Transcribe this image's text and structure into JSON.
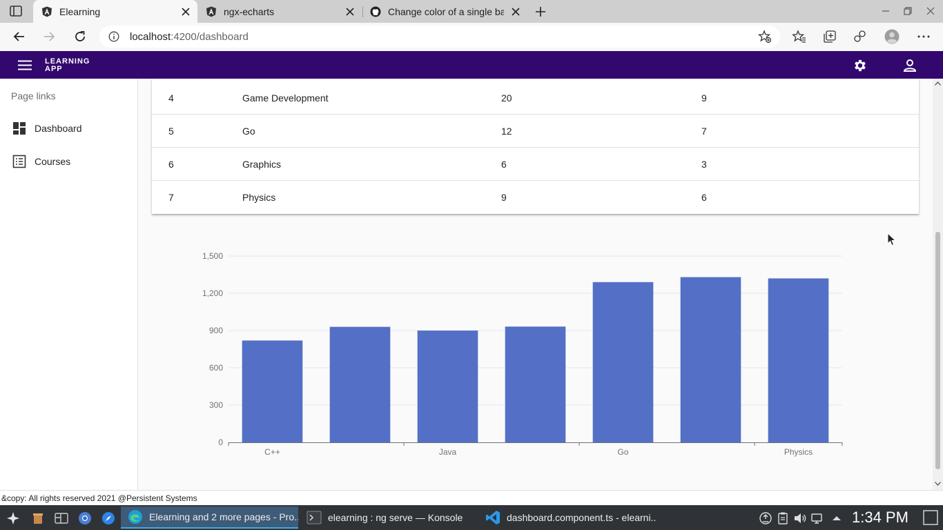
{
  "browser": {
    "tabs": [
      {
        "title": "Elearning",
        "icon": "angular-icon",
        "active": true
      },
      {
        "title": "ngx-echarts",
        "icon": "angular-icon",
        "active": false
      },
      {
        "title": "Change color of a single bar i",
        "icon": "github-icon",
        "active": false
      }
    ],
    "url_host": "localhost",
    "url_path": ":4200/dashboard"
  },
  "app": {
    "brand_line1": "LEARNING",
    "brand_line2": "APP"
  },
  "sidebar": {
    "heading": "Page links",
    "items": [
      {
        "label": "Dashboard",
        "icon": "dashboard-icon"
      },
      {
        "label": "Courses",
        "icon": "list-icon"
      }
    ]
  },
  "table": {
    "rows": [
      {
        "id": "4",
        "name": "Game Development",
        "col3": "20",
        "col4": "9"
      },
      {
        "id": "5",
        "name": "Go",
        "col3": "12",
        "col4": "7"
      },
      {
        "id": "6",
        "name": "Graphics",
        "col3": "6",
        "col4": "3"
      },
      {
        "id": "7",
        "name": "Physics",
        "col3": "9",
        "col4": "6"
      }
    ]
  },
  "chart_data": {
    "type": "bar",
    "categories": [
      "C++",
      "",
      "Java",
      "",
      "Go",
      "",
      "Physics"
    ],
    "values": [
      820,
      930,
      900,
      932,
      1290,
      1330,
      1320
    ],
    "ylim": [
      0,
      1500
    ],
    "yticks": [
      0,
      300,
      600,
      900,
      1200,
      1500
    ],
    "ytick_labels": [
      "0",
      "300",
      "600",
      "900",
      "1,200",
      "1,500"
    ],
    "xtick_labels_shown": [
      "C++",
      "Java",
      "Go",
      "Physics"
    ],
    "bar_color": "#5470c6",
    "grid": true,
    "title": "",
    "xlabel": "",
    "ylabel": ""
  },
  "footer": {
    "text": "&copy: All rights reserved 2021 @Persistent Systems"
  },
  "taskbar": {
    "tasks": [
      {
        "label": "Elearning and 2 more pages - Pro...",
        "active": true
      },
      {
        "label": "elearning : ng serve — Konsole",
        "active": false
      },
      {
        "label": "dashboard.component.ts - elearni...",
        "active": false
      }
    ],
    "clock": "1:34 PM"
  },
  "colors": {
    "appbar": "#33086e",
    "accent": "#5470c6"
  }
}
